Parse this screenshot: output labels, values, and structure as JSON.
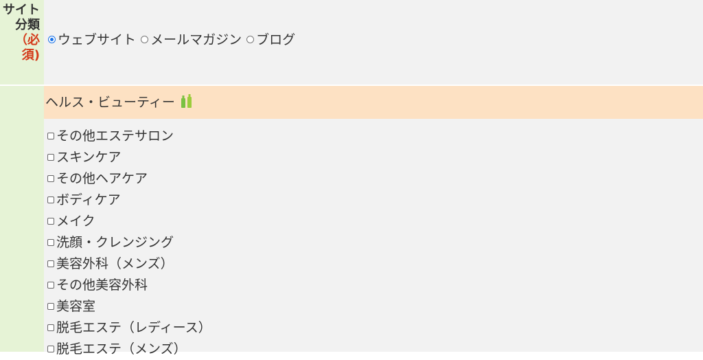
{
  "site_category": {
    "label_lines": [
      "サイト",
      "分類"
    ],
    "required_lines": [
      "（必",
      "須)"
    ],
    "options": [
      {
        "label": "ウェブサイト",
        "checked": true
      },
      {
        "label": "メールマガジン",
        "checked": false
      },
      {
        "label": "ブログ",
        "checked": false
      }
    ]
  },
  "category_group": {
    "title": "ヘルス・ビューティー",
    "icon": "bottles-icon",
    "items": [
      "その他エステサロン",
      "スキンケア",
      "その他ヘアケア",
      "ボディケア",
      "メイク",
      "洗顔・クレンジング",
      "美容外科（メンズ）",
      "その他美容外科",
      "美容室",
      "脱毛エステ（レディース）",
      "脱毛エステ（メンズ）"
    ]
  },
  "colors": {
    "label_bg": "#e6f3d6",
    "content_bg": "#f2f2f2",
    "header_bg": "#fde1c3",
    "required_red": "#d43a1a",
    "icon_green": "#7ac142"
  }
}
